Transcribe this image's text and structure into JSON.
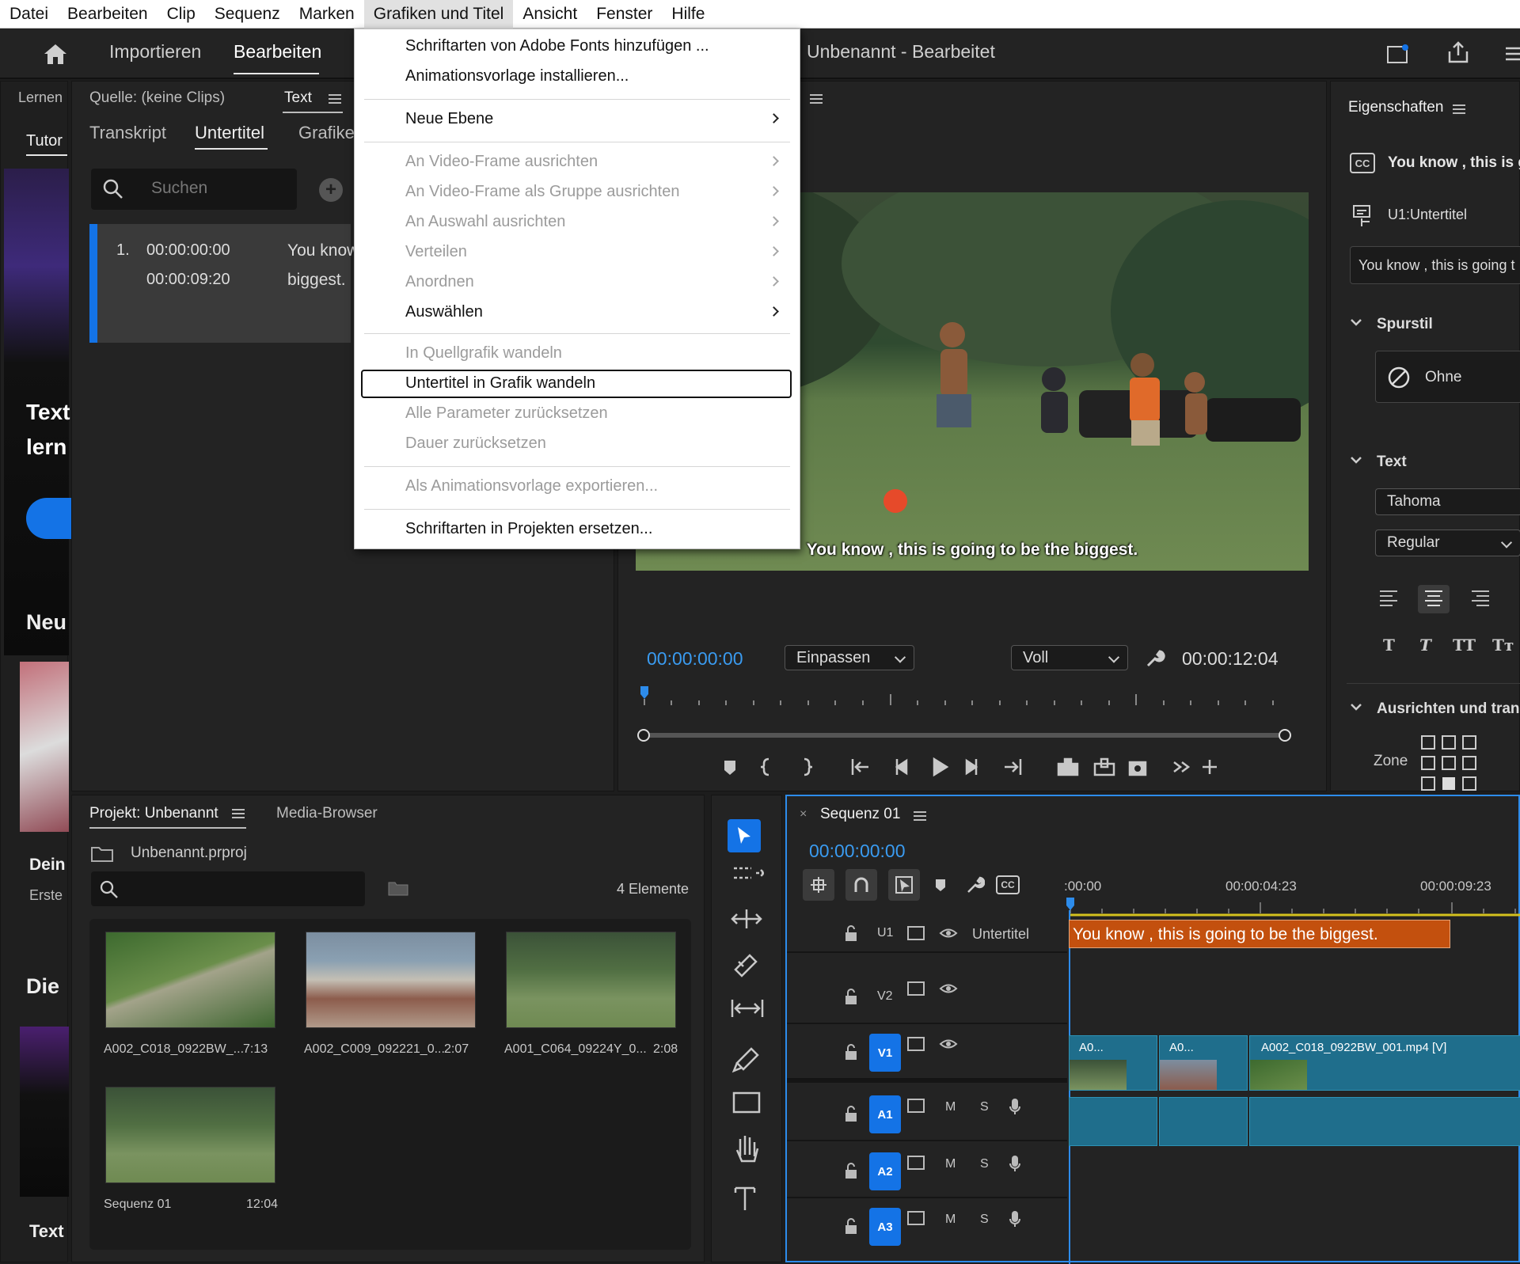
{
  "menubar": [
    "Datei",
    "Bearbeiten",
    "Clip",
    "Sequenz",
    "Marken",
    "Grafiken und Titel",
    "Ansicht",
    "Fenster",
    "Hilfe"
  ],
  "header": {
    "import": "Importieren",
    "edit": "Bearbeiten",
    "title": "Unbenannt - Bearbeitet"
  },
  "left_strip": {
    "learn": "Lernen",
    "tutor": "Tutor",
    "text1": "Text",
    "text2": "lern",
    "neu": "Neu",
    "dein": "Dein",
    "erste": "Erste",
    "die": "Die",
    "text3": "Text"
  },
  "source": {
    "tab": "Quelle: (keine Clips)",
    "text_tab": "Text",
    "sub_tabs": [
      "Transkript",
      "Untertitel",
      "Grafiken"
    ],
    "search_placeholder": "Suchen",
    "entry": {
      "num": "1.",
      "in": "00:00:00:00",
      "out": "00:00:09:20",
      "text1": "You know",
      "text2": "biggest."
    }
  },
  "menu": {
    "items": [
      {
        "label": "Schriftarten von Adobe Fonts hinzufügen ...",
        "enabled": true
      },
      {
        "label": "Animationsvorlage installieren...",
        "enabled": true
      },
      {
        "label": "Neue Ebene",
        "enabled": true,
        "submenu": true
      },
      {
        "label": "An Video-Frame ausrichten",
        "enabled": false,
        "submenu": true
      },
      {
        "label": "An Video-Frame als Gruppe ausrichten",
        "enabled": false,
        "submenu": true
      },
      {
        "label": "An Auswahl ausrichten",
        "enabled": false,
        "submenu": true
      },
      {
        "label": "Verteilen",
        "enabled": false,
        "submenu": true
      },
      {
        "label": "Anordnen",
        "enabled": false,
        "submenu": true
      },
      {
        "label": "Auswählen",
        "enabled": true,
        "submenu": true
      },
      {
        "label": "In Quellgrafik wandeln",
        "enabled": false
      },
      {
        "label": "Untertitel in Grafik wandeln",
        "enabled": true,
        "highlighted": true
      },
      {
        "label": "Alle Parameter zurücksetzen",
        "enabled": false
      },
      {
        "label": "Dauer zurücksetzen",
        "enabled": false
      },
      {
        "label": "Als Animationsvorlage exportieren...",
        "enabled": false
      },
      {
        "label": "Schriftarten in Projekten ersetzen...",
        "enabled": true
      }
    ]
  },
  "program": {
    "subtitle": "You know , this is going to be the biggest.",
    "timecode": "00:00:00:00",
    "fit": "Einpassen",
    "quality": "Voll",
    "duration": "00:00:12:04"
  },
  "properties": {
    "title": "Eigenschaften",
    "caption_text": "You know , this is g",
    "track": "U1:Untertitel",
    "text_field": "You know , this is going t",
    "spurstil": "Spurstil",
    "ohne": "Ohne",
    "text_section": "Text",
    "font": "Tahoma",
    "style": "Regular",
    "align_section": "Ausrichten und trans",
    "zone": "Zone"
  },
  "project": {
    "tab": "Projekt: Unbenannt",
    "media_browser": "Media-Browser",
    "file": "Unbenannt.prproj",
    "count": "4 Elemente",
    "items": [
      {
        "name": "A002_C018_0922BW_...",
        "dur": "7:13"
      },
      {
        "name": "A002_C009_092221_0...",
        "dur": "2:07"
      },
      {
        "name": "A001_C064_09224Y_0...",
        "dur": "2:08"
      },
      {
        "name": "Sequenz 01",
        "dur": "12:04"
      }
    ]
  },
  "timeline": {
    "tab": "Sequenz 01",
    "timecode": "00:00:00:00",
    "ruler": [
      ":00:00",
      "00:00:04:23",
      "00:00:09:23"
    ],
    "tracks": {
      "u1": "U1",
      "u1_name": "Untertitel",
      "v2": "V2",
      "v1": "V1",
      "a1": "A1",
      "a2": "A2",
      "a3": "A3",
      "m": "M",
      "s": "S"
    },
    "caption_clip": "You know , this is going to be the biggest.",
    "clips": [
      "A0...",
      "A0...",
      "A002_C018_0922BW_001.mp4 [V]"
    ]
  },
  "colors": {
    "accent": "#1473e6",
    "caption_clip": "#c3500e",
    "timecode": "#3a9bf0"
  }
}
